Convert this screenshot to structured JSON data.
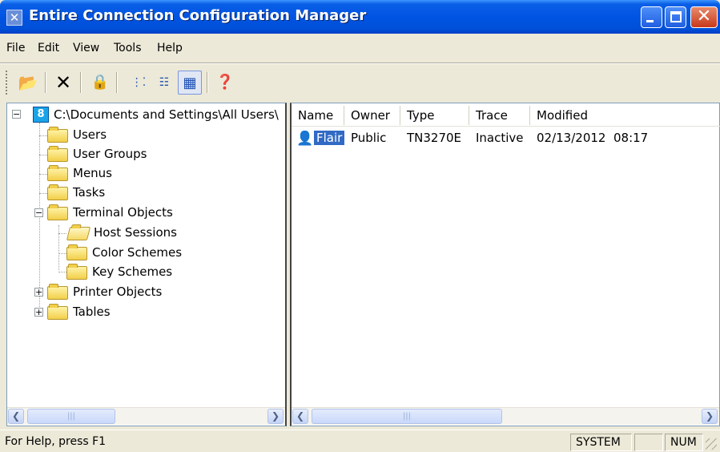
{
  "window": {
    "title": "Entire Connection Configuration Manager",
    "app_icon": "wrench-icon"
  },
  "menu": {
    "file": "File",
    "edit": "Edit",
    "view": "View",
    "tools": "Tools",
    "help": "Help"
  },
  "toolbar": {
    "icons": [
      "open-folder-icon",
      "delete-icon",
      "lock-icon",
      "large-icons-view-icon",
      "list-view-icon",
      "details-view-icon",
      "help-icon"
    ]
  },
  "tree": {
    "root_label": "C:\\Documents and Settings\\All Users\\",
    "nodes": {
      "users": "Users",
      "user_groups": "User Groups",
      "menus": "Menus",
      "tasks": "Tasks",
      "terminal_objects": "Terminal Objects",
      "host_sessions": "Host Sessions",
      "color_schemes": "Color Schemes",
      "key_schemes": "Key Schemes",
      "printer_objects": "Printer Objects",
      "tables": "Tables"
    }
  },
  "list": {
    "columns": {
      "name": "Name",
      "owner": "Owner",
      "type": "Type",
      "trace": "Trace",
      "modified": "Modified"
    },
    "rows": [
      {
        "name": "Flair",
        "owner": "Public",
        "type": "TN3270E",
        "trace": "Inactive",
        "modified": "02/13/2012  08:17"
      }
    ]
  },
  "status": {
    "help_text": "For Help, press F1",
    "system": "SYSTEM",
    "caps": "",
    "num": "NUM"
  }
}
